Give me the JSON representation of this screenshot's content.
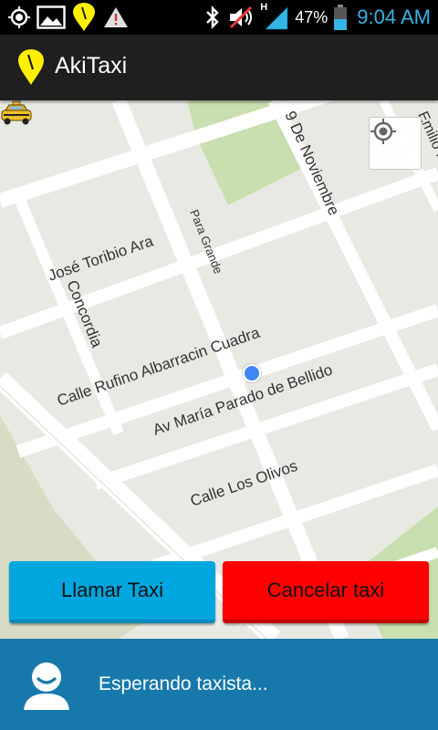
{
  "status_bar": {
    "icons_left": [
      "gps-icon",
      "gallery-icon",
      "akitaxi-notification-icon",
      "warning-icon"
    ],
    "icons_right": [
      "bluetooth-icon",
      "mute-icon",
      "signal-icon",
      "battery-icon"
    ],
    "network": "H",
    "battery_percent": "47%",
    "battery_level": 0.47,
    "time": "9:04 AM",
    "colors": {
      "background": "#000000",
      "time": "#33b5e5",
      "battery": "#33b5e5"
    }
  },
  "app_bar": {
    "title": "AkiTaxi",
    "logo_icon": "yellow-pin-logo-icon",
    "colors": {
      "background": "#1f1f1f",
      "logo": "#ffef00"
    }
  },
  "map": {
    "streets": {
      "jose_toribio_ara": "José Toribio Ara",
      "nueve_de_noviembre": "9 De Noviembre",
      "emilio": "Emilio F",
      "para_grande": "Para Grande",
      "concordia": "Concordia",
      "rufino_albarracin": "Calle Rufino Albarracin Cuadra",
      "maria_parado": "Av María Parado de Bellido",
      "los_olivos": "Calle Los Olivos"
    },
    "locate_button_icon": "my-location-icon",
    "taxi_marker_icon": "taxi-icon",
    "user_location_icon": "blue-dot-icon"
  },
  "actions": {
    "call_label": "Llamar Taxi",
    "cancel_label": "Cancelar taxi",
    "colors": {
      "call": "#00a6de",
      "cancel": "#ff0000"
    }
  },
  "status_panel": {
    "message": "Esperando taxista...",
    "avatar_icon": "user-avatar-icon",
    "colors": {
      "background": "#1779ab"
    }
  }
}
